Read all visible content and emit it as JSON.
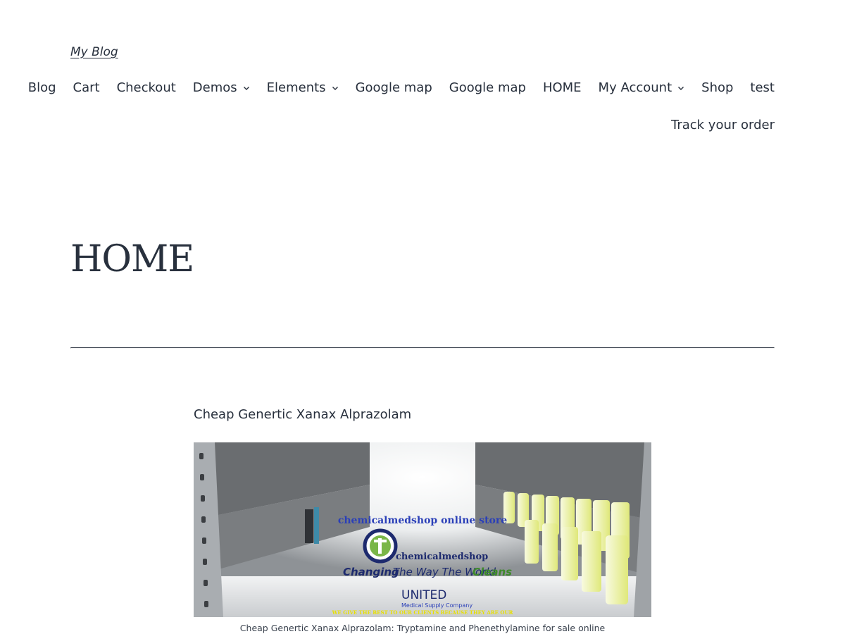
{
  "site": {
    "title": "My Blog"
  },
  "nav": {
    "row1": [
      {
        "label": "Blog",
        "dropdown": false
      },
      {
        "label": "Cart",
        "dropdown": false
      },
      {
        "label": "Checkout",
        "dropdown": false
      },
      {
        "label": "Demos",
        "dropdown": true
      },
      {
        "label": "Elements",
        "dropdown": true
      },
      {
        "label": "Google map",
        "dropdown": false
      },
      {
        "label": "Google map",
        "dropdown": false
      },
      {
        "label": "HOME",
        "dropdown": false
      },
      {
        "label": "My Account",
        "dropdown": true
      },
      {
        "label": "Shop",
        "dropdown": false
      },
      {
        "label": "test",
        "dropdown": false
      }
    ],
    "row2": [
      {
        "label": "Track your order",
        "dropdown": false
      }
    ]
  },
  "page": {
    "title": "HOME",
    "heading": "Cheap Genertic Xanax Alprazolam",
    "image": {
      "banner_text": "chemicalmedshop online store",
      "brand": "chemicalmedshop",
      "slogan_1": "Changing",
      "slogan_2": "The Way The World",
      "slogan_3": "Cleans",
      "company_1": "UNITED",
      "company_2": "Medical Supply Company",
      "footer_text": "WE GIVE THE BEST TO OUR CLIENTS BECAUSE THEY ARE OUR"
    },
    "caption": "Cheap Genertic Xanax Alprazolam: Tryptamine and Phenethylamine for sale online"
  },
  "colors": {
    "text": "#28303d",
    "banner_blue": "#2a3fb8",
    "slogan_navy": "#1d2a6e",
    "slogan_green": "#3e8a2a",
    "logo_green": "#7ab648",
    "footer_yellow": "#e8e000",
    "bottle_fill": "#e6ef8a"
  }
}
